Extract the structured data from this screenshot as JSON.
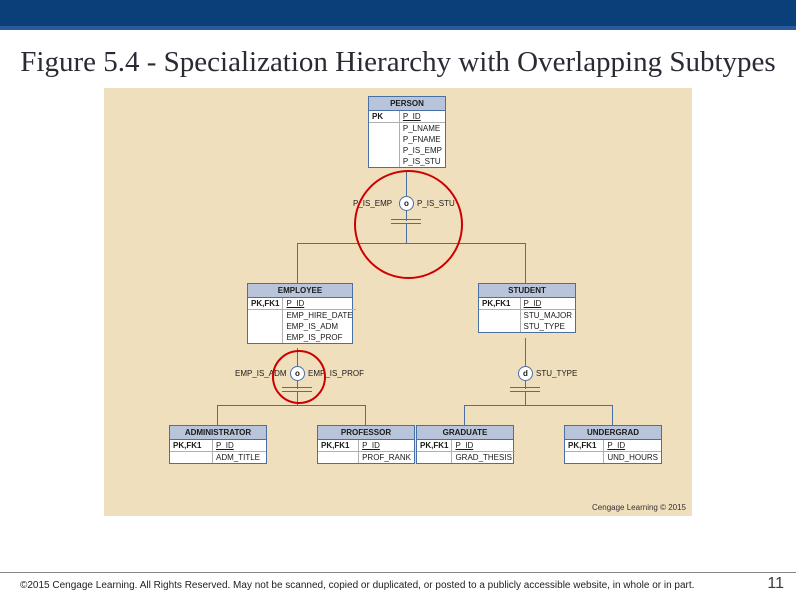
{
  "title": "Figure 5.4 - Specialization Hierarchy with Overlapping Subtypes",
  "entities": {
    "person": {
      "name": "PERSON",
      "pk_label": "PK",
      "pk_attr": "P_ID",
      "attrs": [
        "P_LNAME",
        "P_FNAME",
        "P_IS_EMP",
        "P_IS_STU"
      ]
    },
    "employee": {
      "name": "EMPLOYEE",
      "pk_label": "PK,FK1",
      "pk_attr": "P_ID",
      "attrs": [
        "EMP_HIRE_DATE",
        "EMP_IS_ADM",
        "EMP_IS_PROF"
      ]
    },
    "student": {
      "name": "STUDENT",
      "pk_label": "PK,FK1",
      "pk_attr": "P_ID",
      "attrs": [
        "STU_MAJOR",
        "STU_TYPE"
      ]
    },
    "administrator": {
      "name": "ADMINISTRATOR",
      "pk_label": "PK,FK1",
      "pk_attr": "P_ID",
      "attrs": [
        "ADM_TITLE"
      ]
    },
    "professor": {
      "name": "PROFESSOR",
      "pk_label": "PK,FK1",
      "pk_attr": "P_ID",
      "attrs": [
        "PROF_RANK"
      ]
    },
    "graduate": {
      "name": "GRADUATE",
      "pk_label": "PK,FK1",
      "pk_attr": "P_ID",
      "attrs": [
        "GRAD_THESIS"
      ]
    },
    "undergrad": {
      "name": "UNDERGRAD",
      "pk_label": "PK,FK1",
      "pk_attr": "P_ID",
      "attrs": [
        "UND_HOURS"
      ]
    }
  },
  "discriminators": {
    "top": {
      "symbol": "o",
      "left_label": "P_IS_EMP",
      "right_label": "P_IS_STU"
    },
    "emp": {
      "symbol": "o",
      "left_label": "EMP_IS_ADM",
      "right_label": "EMP_IS_PROF"
    },
    "stu": {
      "symbol": "d",
      "right_label": "STU_TYPE"
    }
  },
  "cengage_inner": "Cengage Learning © 2015",
  "footer_copy": "©2015 Cengage Learning. All Rights Reserved. May not be scanned, copied or duplicated, or posted to a publicly accessible website, in whole or in part.",
  "slide_num": "11"
}
